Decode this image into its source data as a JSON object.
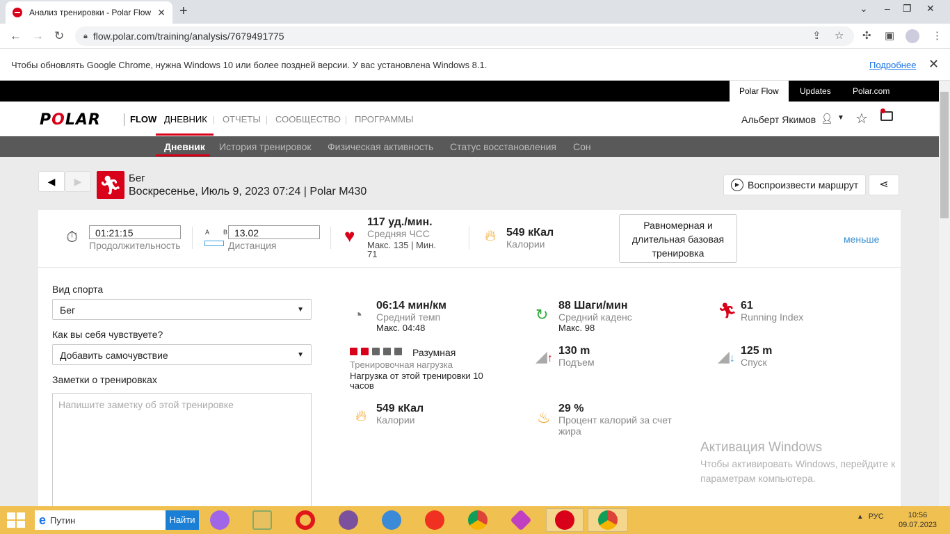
{
  "browser": {
    "tab_title": "Анализ тренировки - Polar Flow",
    "url": "flow.polar.com/training/analysis/7679491775",
    "infobar_message": "Чтобы обновлять Google Chrome, нужна Windows 10 или более поздней версии. У вас установлена Windows 8.1.",
    "infobar_link": "Подробнее"
  },
  "topbar": {
    "items": [
      "Polar Flow",
      "Updates",
      "Polar.com"
    ]
  },
  "header": {
    "logo": "POLAR",
    "flow": "FLOW",
    "nav": [
      "ДНЕВНИК",
      "ОТЧЕТЫ",
      "СООБЩЕСТВО",
      "ПРОГРАММЫ"
    ],
    "user": "Альберт Якимов"
  },
  "subnav": {
    "items": [
      "Дневник",
      "История тренировок",
      "Физическая активность",
      "Статус восстановления",
      "Сон"
    ]
  },
  "session": {
    "sport": "Бег",
    "datetime": "Воскресенье, Июль 9, 2023 07:24 | Polar M430",
    "route_button": "Воспроизвести маршрут"
  },
  "summary": {
    "duration": {
      "value": "01:21:15",
      "label": "Продолжительность"
    },
    "distance": {
      "ab": "A B",
      "value": "13.02",
      "label": "Дистанция"
    },
    "hr": {
      "value": "117 уд./мин.",
      "label": "Средняя ЧСС",
      "maxmin_line1": "Макс. 135  |  Мин.",
      "maxmin_line2": "71"
    },
    "calories": {
      "value": "549 кКал",
      "label": "Калории"
    },
    "zone_line1": "Равномерная и",
    "zone_line2": "длительная базовая",
    "zone_line3": "тренировка",
    "less": "меньше"
  },
  "form": {
    "sport_label": "Вид спорта",
    "sport_value": "Бег",
    "feeling_label": "Как вы себя чувствуете?",
    "feeling_value": "Добавить самочувствие",
    "notes_label": "Заметки о тренировках",
    "notes_placeholder": "Напишите заметку об этой тренировке"
  },
  "metrics": {
    "pace": {
      "value": "06:14 мин/км",
      "label": "Средний темп",
      "sub": "Макс. 04:48"
    },
    "cadence": {
      "value": "88 Шаги/мин",
      "label": "Средний каденс",
      "sub": "Макс. 98"
    },
    "running_index": {
      "value": "61",
      "label": "Running Index"
    },
    "load": {
      "level": "Разумная",
      "label": "Тренировочная нагрузка",
      "sub_line1": "Нагрузка от этой тренировки 10",
      "sub_line2": "часов",
      "filled": 2,
      "total": 5
    },
    "ascent": {
      "value": "130 m",
      "label": "Подъем"
    },
    "descent": {
      "value": "125 m",
      "label": "Спуск"
    },
    "calories": {
      "value": "549 кКал",
      "label": "Калории"
    },
    "fat": {
      "value": "29 %",
      "label_line1": "Процент калорий за счет",
      "label_line2": "жира"
    }
  },
  "watermark": {
    "title": "Активация Windows",
    "line1": "Чтобы активировать Windows, перейдите к",
    "line2": "параметрам компьютера."
  },
  "taskbar": {
    "search": "Путин",
    "find": "Найти",
    "lang": "РУС",
    "time": "10:56",
    "date": "09.07.2023"
  },
  "colors": {
    "brand": "#d90019",
    "taskbar": "#f0c050",
    "link": "#3b8fcf"
  }
}
